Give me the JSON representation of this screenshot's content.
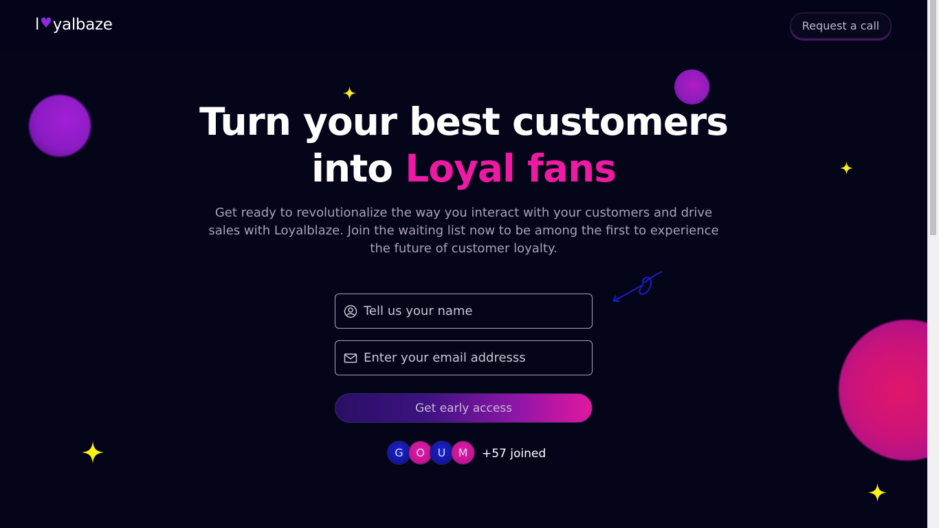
{
  "header": {
    "logo_prefix": "l",
    "logo_suffix": "yalbaze",
    "request_call_label": "Request a call"
  },
  "hero": {
    "headline_line1": "Turn your best customers",
    "headline_line2_prefix": "into",
    "headline_accent": "Loyal fans",
    "subtext": "Get ready to revolutionalize the way you interact with your customers and drive sales with Loyalblaze. Join the waiting list now to be among the first to experience the future of customer loyalty."
  },
  "form": {
    "name_placeholder": "Tell us your name",
    "email_placeholder": "Enter your email addresss",
    "submit_label": "Get early access"
  },
  "social_proof": {
    "avatars": [
      "G",
      "O",
      "U",
      "M"
    ],
    "joined_text": "+57 joined"
  },
  "colors": {
    "background": "#05051a",
    "accent_pink": "#ed1aa2",
    "sparkle_yellow": "#f7f21a",
    "avatar_blue": "#1414a0",
    "avatar_pink": "#c2148e"
  },
  "icons": {
    "logo_heart": "heart-icon",
    "name_field": "user-circle-icon",
    "email_field": "envelope-icon",
    "decor": "sparkle-icon"
  }
}
